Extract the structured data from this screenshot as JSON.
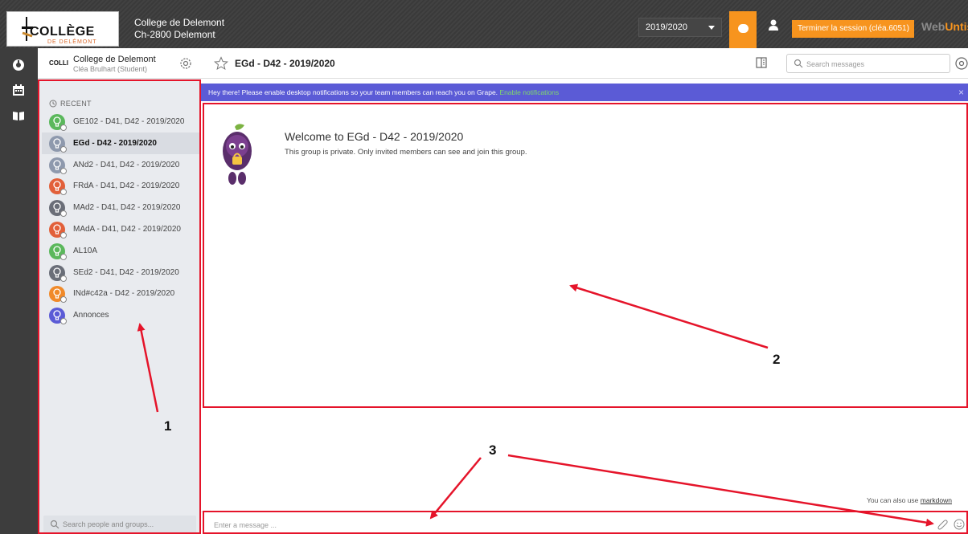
{
  "topbar": {
    "logo_text": "COLLÈGE",
    "logo_subtext": "DE DELÉMONT",
    "school_name": "College de Delemont",
    "school_city": "Ch-2800 Delemont",
    "school_year": "2019/2020",
    "logout_label": "Terminer la session (cléa.6051)",
    "brand_web": "Web",
    "brand_untis": "Untis"
  },
  "sidebar": {
    "logo_text": "COLLI",
    "org_name": "College de Delemont",
    "user_name": "Cléa Brulhart (Student)",
    "recent_label": "RECENT",
    "groups": [
      {
        "label": "GE102 - D41, D42 - 2019/2020",
        "color": "#5bb85c"
      },
      {
        "label": "EGd - D42 - 2019/2020",
        "color": "#8e99ad"
      },
      {
        "label": "ANd2 - D41, D42 - 2019/2020",
        "color": "#8e99ad"
      },
      {
        "label": "FRdA - D41, D42 - 2019/2020",
        "color": "#e2603a"
      },
      {
        "label": "MAd2 - D41, D42 - 2019/2020",
        "color": "#6a6e78"
      },
      {
        "label": "MAdA - D41, D42 - 2019/2020",
        "color": "#e2603a"
      },
      {
        "label": "AL10A",
        "color": "#5bb85c"
      },
      {
        "label": "SEd2 - D41, D42 - 2019/2020",
        "color": "#6a6e78"
      },
      {
        "label": "INd#c42a - D42 - 2019/2020",
        "color": "#f08a2a"
      },
      {
        "label": "Annonces",
        "color": "#5b5bd6"
      }
    ],
    "active_index": 1,
    "search_placeholder": "Search people and groups..."
  },
  "main": {
    "channel_title": "EGd - D42 - 2019/2020",
    "search_placeholder": "Search messages",
    "notification_text": "Hey there! Please enable desktop notifications so your team members can reach you on Grape.",
    "notification_link": "Enable notifications",
    "notification_close": "×",
    "welcome_title": "Welcome to EGd - D42 - 2019/2020",
    "welcome_subtitle": "This group is private. Only invited members can see and join this group.",
    "markdown_prefix": "You can also use",
    "markdown_link": "markdown",
    "message_placeholder": "Enter a message ..."
  },
  "annotations": {
    "label_1": "1",
    "label_2": "2",
    "label_3": "3",
    "color": "#e5142a"
  }
}
